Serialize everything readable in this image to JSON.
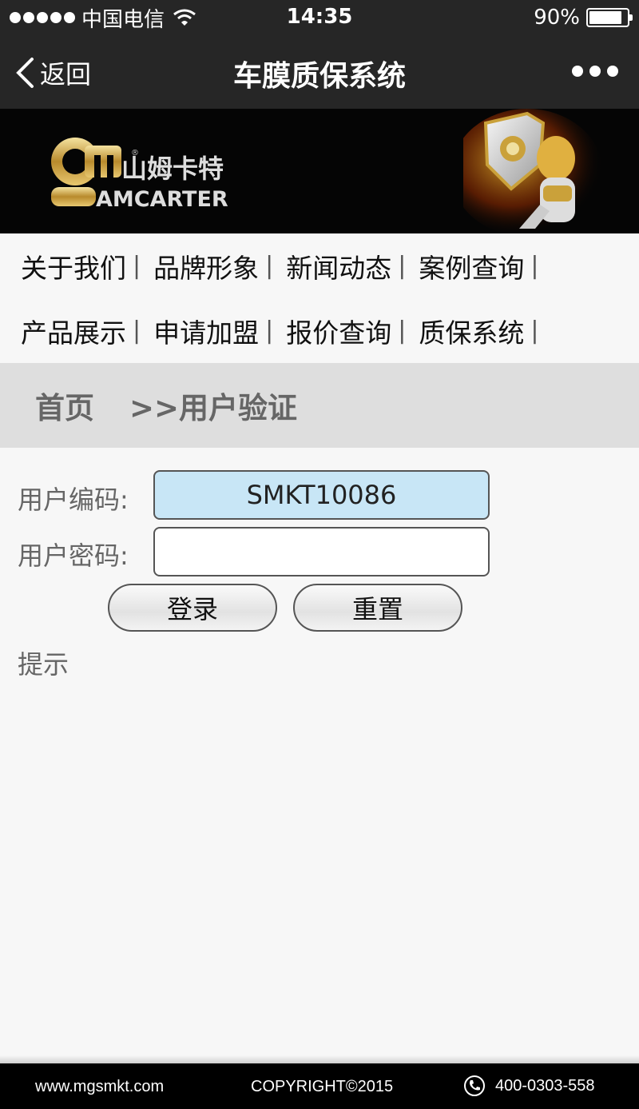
{
  "status_bar": {
    "carrier": "中国电信",
    "time": "14:35",
    "battery": "90%",
    "battery_level": 0.9
  },
  "nav": {
    "back_label": "返回",
    "title": "车膜质保系统"
  },
  "banner": {
    "brand_cn": "山姆卡特",
    "brand_en": "AMCARTER",
    "registered": "®"
  },
  "menu": {
    "rows": [
      [
        "关于我们",
        "品牌形象",
        "新闻动态",
        "案例查询"
      ],
      [
        "产品展示",
        "申请加盟",
        "报价查询",
        "质保系统"
      ]
    ],
    "separator": "|"
  },
  "breadcrumb": {
    "home": "首页",
    "current": ">>用户验证"
  },
  "form": {
    "user_code_label": "用户编码:",
    "user_code_value": "SMKT10086",
    "password_label": "用户密码:",
    "password_value": "",
    "login_button": "登录",
    "reset_button": "重置",
    "hint": "提示"
  },
  "footer": {
    "url": "www.mgsmkt.com",
    "copyright": "COPYRIGHT©2015",
    "phone": "400-0303-558"
  },
  "colors": {
    "bar_bg": "#262626",
    "input_active_bg": "#c8e6f6",
    "breadcrumb_bg": "#dedede"
  }
}
